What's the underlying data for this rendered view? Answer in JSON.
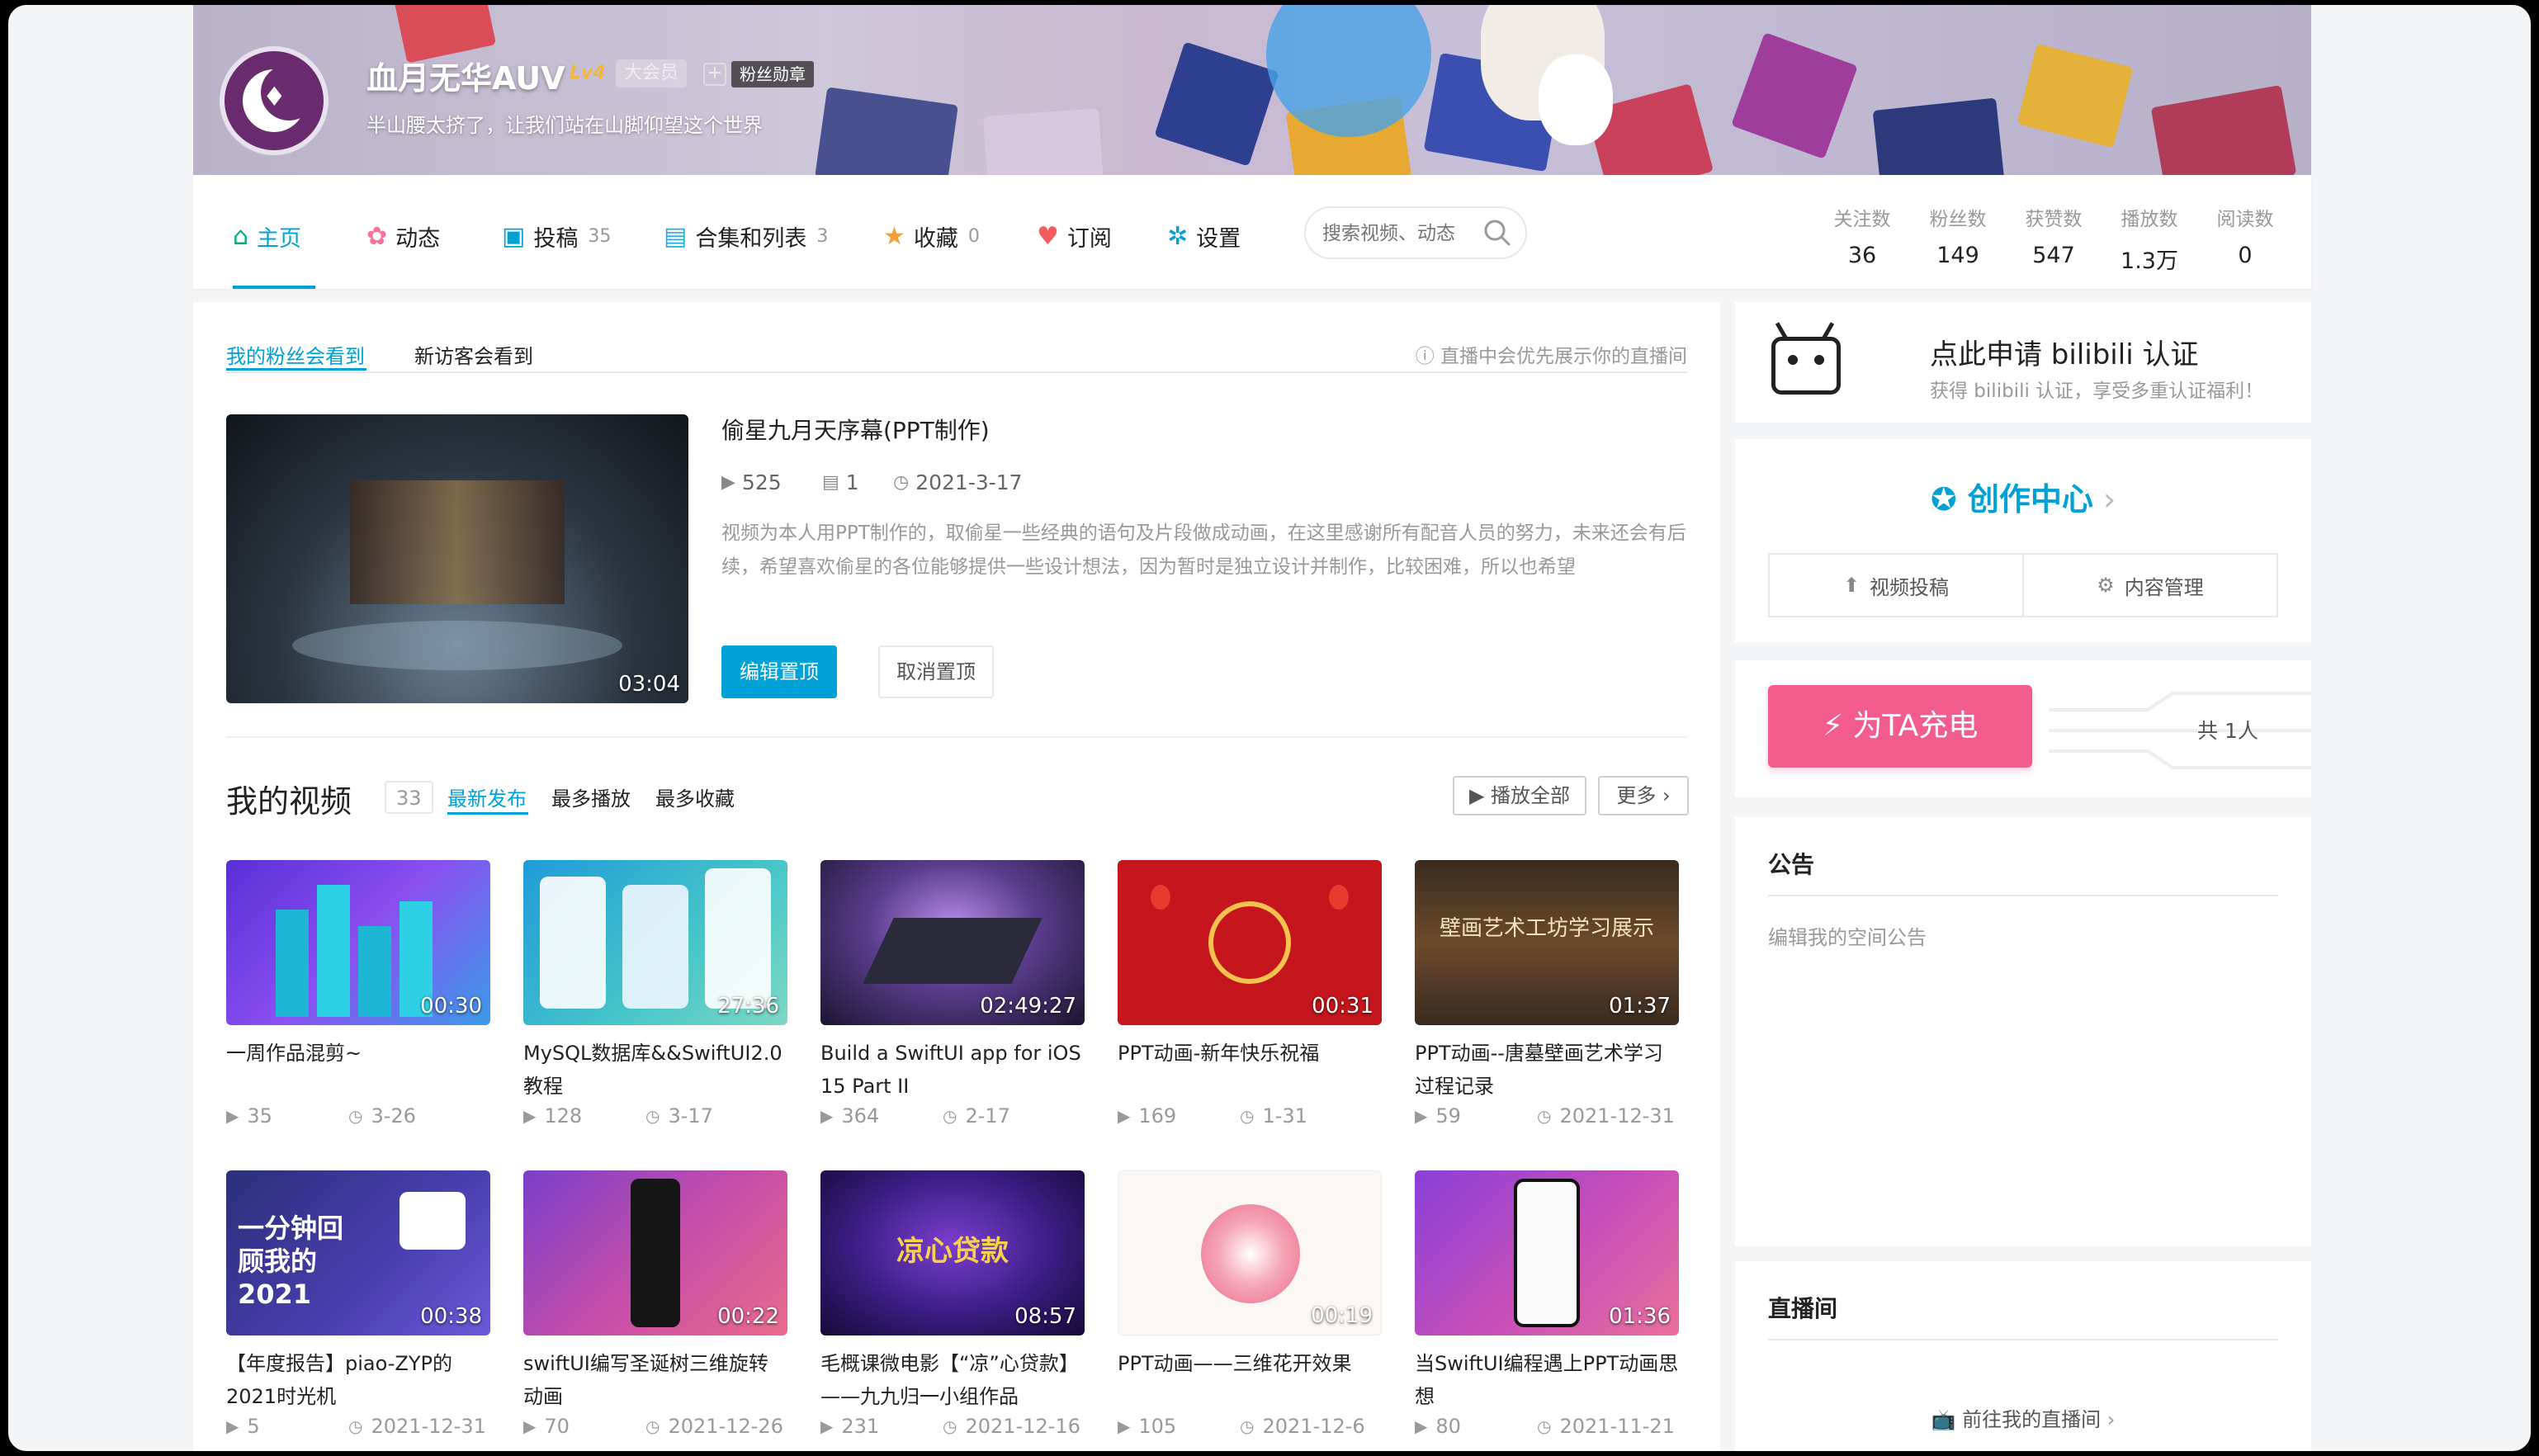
{
  "profile": {
    "username": "血月无华AUV",
    "level": "Lv4",
    "vip_label": "大会员",
    "fan_badge_plus": "+",
    "fan_badge_label": "粉丝勋章",
    "signature": "半山腰太挤了，让我们站在山脚仰望这个世界"
  },
  "nav": {
    "items": [
      {
        "label": "主页",
        "icon": "home-icon",
        "count": ""
      },
      {
        "label": "动态",
        "icon": "dynamic-icon",
        "count": ""
      },
      {
        "label": "投稿",
        "icon": "upload-icon",
        "count": "35"
      },
      {
        "label": "合集和列表",
        "icon": "collection-icon",
        "count": "3"
      },
      {
        "label": "收藏",
        "icon": "favorite-icon",
        "count": "0"
      },
      {
        "label": "订阅",
        "icon": "heart-icon",
        "count": ""
      },
      {
        "label": "设置",
        "icon": "gear-icon",
        "count": ""
      }
    ],
    "search_placeholder": "搜索视频、动态"
  },
  "stats": [
    {
      "label": "关注数",
      "value": "36"
    },
    {
      "label": "粉丝数",
      "value": "149"
    },
    {
      "label": "获赞数",
      "value": "547"
    },
    {
      "label": "播放数",
      "value": "1.3万"
    },
    {
      "label": "阅读数",
      "value": "0"
    }
  ],
  "pinned": {
    "tab_fans": "我的粉丝会看到",
    "tab_guests": "新访客会看到",
    "live_note": "直播中会优先展示你的直播间",
    "title": "偷星九月天序幕(PPT制作)",
    "duration": "03:04",
    "plays": "525",
    "danmaku": "1",
    "date": "2021-3-17",
    "description": "视频为本人用PPT制作的，取偷星一些经典的语句及片段做成动画，在这里感谢所有配音人员的努力，未来还会有后续，希望喜欢偷星的各位能够提供一些设计想法，因为暂时是独立设计并制作，比较困难，所以也希望",
    "edit_label": "编辑置顶",
    "unpin_label": "取消置顶"
  },
  "my_videos": {
    "title": "我的视频",
    "count": "33",
    "sort_tabs": [
      "最新发布",
      "最多播放",
      "最多收藏"
    ],
    "play_all": "播放全部",
    "more": "更多",
    "videos": [
      {
        "title": "一周作品混剪~",
        "duration": "00:30",
        "plays": "35",
        "date": "3-26",
        "thumb_text": ""
      },
      {
        "title": "MySQL数据库&&SwiftUI2.0教程",
        "duration": "27:36",
        "plays": "128",
        "date": "3-17",
        "thumb_text": ""
      },
      {
        "title": "Build a SwiftUI app for iOS 15 Part II",
        "duration": "02:49:27",
        "plays": "364",
        "date": "2-17",
        "thumb_text": ""
      },
      {
        "title": "PPT动画-新年快乐祝福",
        "duration": "00:31",
        "plays": "169",
        "date": "1-31",
        "thumb_text": ""
      },
      {
        "title": "PPT动画--唐墓壁画艺术学习过程记录",
        "duration": "01:37",
        "plays": "59",
        "date": "2021-12-31",
        "thumb_text": "壁画艺术工坊学习展示"
      },
      {
        "title": "【年度报告】piao-ZYP的2021时光机",
        "duration": "00:38",
        "plays": "5",
        "date": "2021-12-31",
        "thumb_text": "一分钟回顾我的2021"
      },
      {
        "title": "swiftUI编写圣诞树三维旋转动画",
        "duration": "00:22",
        "plays": "70",
        "date": "2021-12-26",
        "thumb_text": ""
      },
      {
        "title": "毛概课微电影【“凉”心贷款】——九九归一小组作品",
        "duration": "08:57",
        "plays": "231",
        "date": "2021-12-16",
        "thumb_text": "凉心贷款"
      },
      {
        "title": "PPT动画——三维花开效果",
        "duration": "00:19",
        "plays": "105",
        "date": "2021-12-6",
        "thumb_text": ""
      },
      {
        "title": "当SwiftUI编程遇上PPT动画思想",
        "duration": "01:36",
        "plays": "80",
        "date": "2021-11-21",
        "thumb_text": ""
      }
    ]
  },
  "sidebar": {
    "cert_title": "点此申请 bilibili 认证",
    "cert_sub": "获得 bilibili 认证，享受多重认证福利！",
    "creator_title": "创作中心",
    "creator_btn_upload": "视频投稿",
    "creator_btn_content": "内容管理",
    "charge_label": "为TA充电",
    "charge_count": "共 1人",
    "notice_title": "公告",
    "notice_edit": "编辑我的空间公告",
    "live_title": "直播间",
    "live_link": "前往我的直播间"
  },
  "colors": {
    "accent": "#00a1d6",
    "charge": "#f25d8e",
    "vip": "#f5b63a"
  }
}
